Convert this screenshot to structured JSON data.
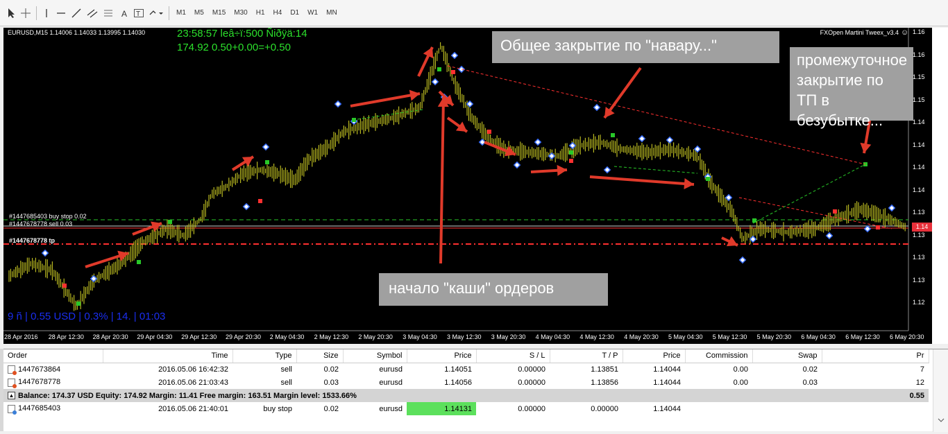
{
  "toolbar": {
    "tools": [
      "cursor-icon",
      "crosshair-icon",
      "vertical-line-icon",
      "horizontal-line-icon",
      "trendline-icon",
      "equidistant-channel-icon",
      "fibonacci-icon",
      "text-icon",
      "text-label-icon",
      "arrows-icon"
    ],
    "timeframes": [
      "M1",
      "M5",
      "M15",
      "M30",
      "H1",
      "H4",
      "D1",
      "W1",
      "MN"
    ]
  },
  "chart": {
    "symbol_line": "EURUSD,M15  1.14006 1.14033 1.13995 1.14030",
    "expert_name": "FXOpen Martini Tweex_v3.4",
    "info_line1": "23:58:57 lеâ÷ї:500 Ñiðÿä:14",
    "info_line2": "174.92    0.50+0.00=+0.50",
    "bottom_stat": "9 ñ | 0.55 USD | 0.3% | 14. | 01:03",
    "line_labels": {
      "buy_stop": "#1447685403 buy stop 0.02",
      "sell": "#1447678778 sell 0.03",
      "tp": "#1447678778 tp"
    },
    "price_axis": [
      "1.16",
      "1.16",
      "1.15",
      "1.15",
      "1.14",
      "1.14",
      "1.14",
      "1.14",
      "1.13",
      "1.13",
      "1.13",
      "1.13",
      "1.12"
    ],
    "price_tag": "1.14",
    "time_axis": [
      "28 Apr 2016",
      "28 Apr 12:30",
      "28 Apr 20:30",
      "29 Apr 04:30",
      "29 Apr 12:30",
      "29 Apr 20:30",
      "2 May 04:30",
      "2 May 12:30",
      "2 May 20:30",
      "3 May 04:30",
      "3 May 12:30",
      "3 May 20:30",
      "4 May 04:30",
      "4 May 12:30",
      "4 May 20:30",
      "5 May 04:30",
      "5 May 12:30",
      "5 May 20:30",
      "6 May 04:30",
      "6 May 12:30",
      "6 May 20:30"
    ],
    "annotations": {
      "general_close": "Общее закрытие по \"навару...\"",
      "intermediate_close": "промежуточное закрытие по ТП в безубытке...",
      "mess_start": "начало \"каши\" ордеров"
    },
    "colors": {
      "candle": "#b8b820",
      "arrow": "#e03a2a",
      "grid": "#3a3a3a",
      "buy": "#3a70ff",
      "sell": "#ff3030",
      "green": "#28c828",
      "callout": "#a0a0a0"
    }
  },
  "terminal": {
    "columns": [
      "Order",
      "Time",
      "Type",
      "Size",
      "Symbol",
      "Price",
      "S / L",
      "T / P",
      "Price",
      "Commission",
      "Swap",
      "Pr"
    ],
    "rows": [
      {
        "order": "1447673864",
        "time": "2016.05.06 16:42:32",
        "type": "sell",
        "size": "0.02",
        "symbol": "eurusd",
        "price": "1.14051",
        "sl": "0.00000",
        "tp": "1.13851",
        "price2": "1.14044",
        "commission": "0.00",
        "swap": "0.02",
        "profit": "7"
      },
      {
        "order": "1447678778",
        "time": "2016.05.06 21:03:43",
        "type": "sell",
        "size": "0.03",
        "symbol": "eurusd",
        "price": "1.14056",
        "sl": "0.00000",
        "tp": "1.13856",
        "price2": "1.14044",
        "commission": "0.00",
        "swap": "0.03",
        "profit": "12"
      }
    ],
    "balance": "Balance: 174.37 USD  Equity: 174.92  Margin: 11.41  Free margin: 163.51  Margin level: 1533.66%",
    "balance_profit": "0.55",
    "pending": {
      "order": "1447685403",
      "time": "2016.05.06 21:40:01",
      "type": "buy stop",
      "size": "0.02",
      "symbol": "eurusd",
      "price": "1.14131",
      "sl": "0.00000",
      "tp": "0.00000",
      "price2": "1.14044",
      "commission": "",
      "swap": "",
      "profit": ""
    }
  }
}
